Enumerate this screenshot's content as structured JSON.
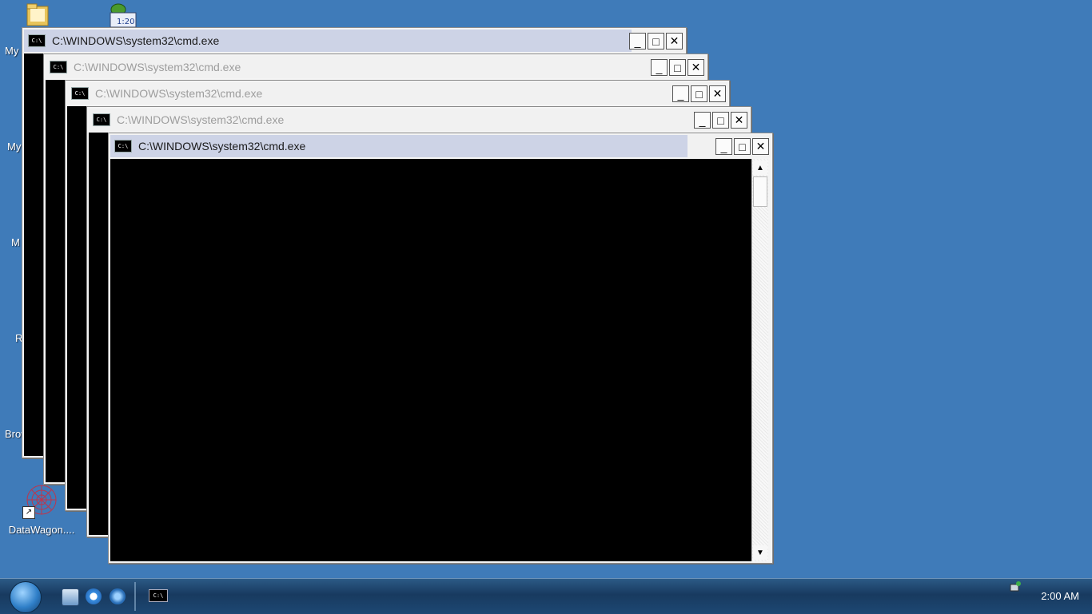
{
  "desktop": {
    "partial_labels": [
      "My",
      "My",
      "M",
      "R",
      "Brov"
    ],
    "shortcut_label": "DataWagon...."
  },
  "windows": [
    {
      "title": "C:\\WINDOWS\\system32\\cmd.exe",
      "icon_text": "C:\\"
    },
    {
      "title": "C:\\WINDOWS\\system32\\cmd.exe",
      "icon_text": "C:\\"
    },
    {
      "title": "C:\\WINDOWS\\system32\\cmd.exe",
      "icon_text": "C:\\"
    },
    {
      "title": "C:\\WINDOWS\\system32\\cmd.exe",
      "icon_text": "C:\\"
    },
    {
      "title": "C:\\WINDOWS\\system32\\cmd.exe",
      "icon_text": "C:\\"
    }
  ],
  "controls": {
    "minimize": "_",
    "maximize": "□",
    "close": "✕",
    "scroll_up": "▲",
    "scroll_down": "▼"
  },
  "taskbar": {
    "task_icon_text": "C:\\",
    "clock": "2:00 AM"
  },
  "colors": {
    "desktop": "#3f7bb9",
    "active_title": "#cdd3e6"
  }
}
